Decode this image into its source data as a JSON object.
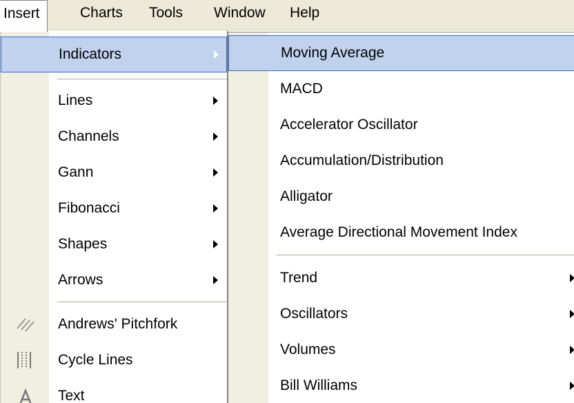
{
  "menubar": {
    "items": [
      {
        "label": "Insert",
        "open": true
      },
      {
        "label": "Charts"
      },
      {
        "label": "Tools"
      },
      {
        "label": "Window"
      },
      {
        "label": "Help"
      }
    ]
  },
  "insert_menu": {
    "items": [
      {
        "label": "Indicators",
        "submenu": true,
        "highlighted": true
      },
      {
        "label": "Lines",
        "submenu": true
      },
      {
        "label": "Channels",
        "submenu": true
      },
      {
        "label": "Gann",
        "submenu": true
      },
      {
        "label": "Fibonacci",
        "submenu": true
      },
      {
        "label": "Shapes",
        "submenu": true
      },
      {
        "label": "Arrows",
        "submenu": true
      },
      {
        "label": "Andrews' Pitchfork",
        "icon": "pitchfork-icon"
      },
      {
        "label": "Cycle Lines",
        "icon": "cycle-lines-icon"
      },
      {
        "label": "Text",
        "icon": "text-icon"
      }
    ]
  },
  "indicators_submenu": {
    "items": [
      {
        "label": "Moving Average",
        "highlighted": true
      },
      {
        "label": "MACD"
      },
      {
        "label": "Accelerator Oscillator"
      },
      {
        "label": "Accumulation/Distribution"
      },
      {
        "label": "Alligator"
      },
      {
        "label": "Average Directional Movement Index"
      },
      {
        "label": "Trend",
        "submenu": true
      },
      {
        "label": "Oscillators",
        "submenu": true
      },
      {
        "label": "Volumes",
        "submenu": true
      },
      {
        "label": "Bill Williams",
        "submenu": true
      }
    ]
  },
  "colors": {
    "highlight_fill": "#c1d2ee",
    "highlight_border": "#316ac5",
    "menubar_bg": "#ece9d8",
    "icon_strip": "#f1efe2"
  }
}
